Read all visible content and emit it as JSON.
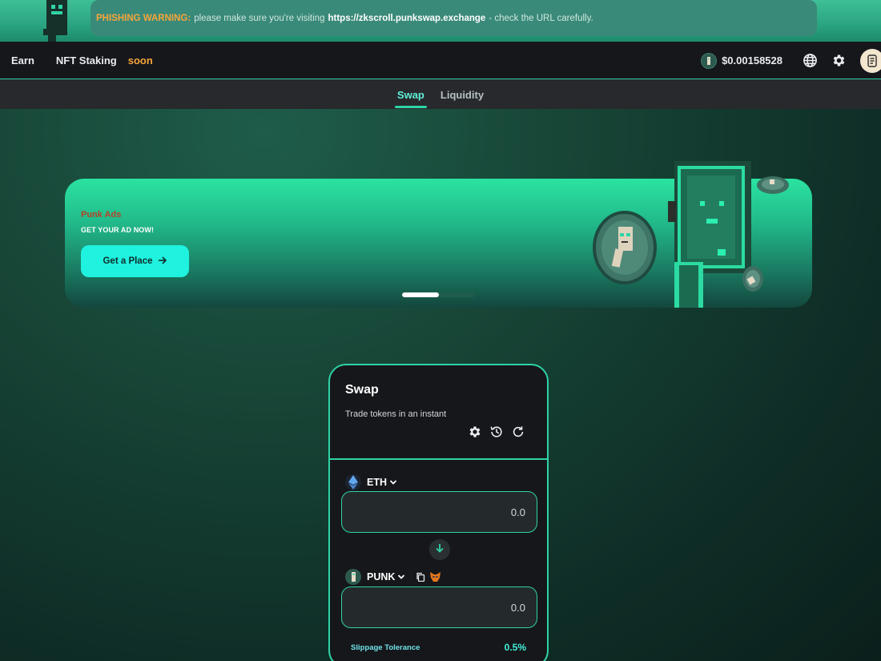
{
  "phishing": {
    "warning_label": "PHISHING WARNING:",
    "message_before": "please make sure you're visiting",
    "url": "https://zkscroll.punkswap.exchange",
    "message_after": "- check the URL carefully."
  },
  "nav": {
    "items": [
      {
        "label": "Earn"
      },
      {
        "label": "NFT Staking"
      }
    ],
    "soon_badge": "soon",
    "token_price": "$0.00158528",
    "icons": [
      "punk-coin-icon",
      "globe-icon",
      "gear-icon",
      "scroll-avatar-icon"
    ]
  },
  "subtabs": [
    {
      "label": "Swap",
      "active": true
    },
    {
      "label": "Liquidity",
      "active": false
    }
  ],
  "ad": {
    "title": "Punk Ads",
    "subtitle": "GET YOUR AD NOW!",
    "button_label": "Get a Place",
    "carousel_progress": 0.5
  },
  "swap": {
    "title": "Swap",
    "subtitle": "Trade tokens in an instant",
    "tools": [
      "settings-icon",
      "history-icon",
      "refresh-icon"
    ],
    "from": {
      "symbol": "ETH",
      "amount": "0.0"
    },
    "to": {
      "symbol": "PUNK",
      "amount": "0.0"
    },
    "slippage_label": "Slippage Tolerance",
    "slippage_value": "0.5%"
  },
  "colors": {
    "accent": "#2fd3a6",
    "warning": "#f7a53b",
    "button": "#1ff2df",
    "card_bg": "#16171b"
  }
}
